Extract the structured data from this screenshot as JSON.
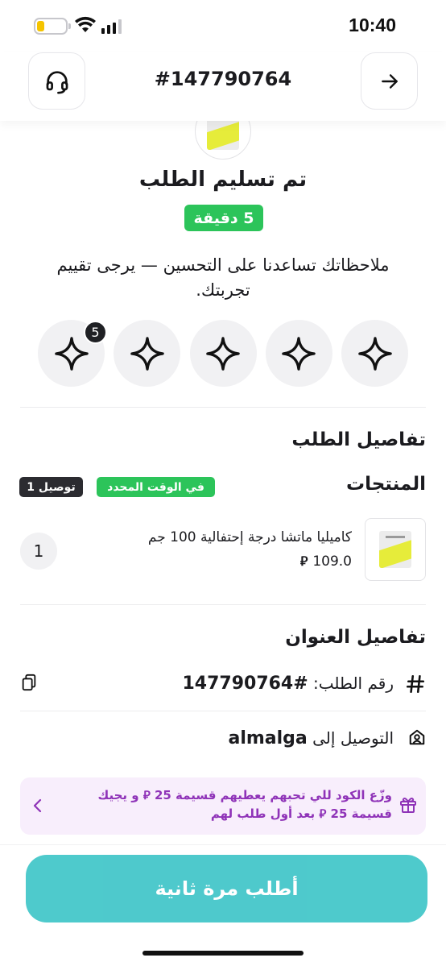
{
  "status_bar": {
    "time": "10:40",
    "battery_level": 0.25
  },
  "header": {
    "order_number": "#147790764",
    "back_icon": "arrow-right-icon",
    "support_icon": "headset-icon"
  },
  "status": {
    "title": "تم تسليم الطلب",
    "time_badge": "5 دقيقة",
    "feedback_text": "ملاحظاتك تساعدنا على التحسين — يرجى تقييم تجربتك.",
    "stars_count": 5,
    "stars_badge": "5"
  },
  "order_details": {
    "title": "تفاصيل الطلب",
    "products_label": "المنتجات",
    "on_time_badge": "في الوقت المحدد",
    "delivery_badge": "توصيل 1",
    "products": [
      {
        "name": "كاميليا ماتشا درجة إحتفالية 100 جم",
        "price": "109.0",
        "currency_symbol": "⃁",
        "quantity": "1"
      }
    ]
  },
  "address_details": {
    "title": "تفاصيل العنوان",
    "order_number_label": "رقم الطلب:",
    "order_number_value": "#147790764",
    "delivery_label": "التوصيل إلى",
    "delivery_value": "almalga"
  },
  "gift_banner": {
    "text": "وزّع الكود للي تحبهم يعطيهم قسيمة 25 ⃁ و يجيك قسيمة 25 ⃁ بعد أول طلب لهم"
  },
  "bottom": {
    "reorder_label": "أطلب مرة ثانية"
  },
  "colors": {
    "green": "#2cc45a",
    "teal": "#3fc5c8",
    "purple": "#8f33b8",
    "dark_pill": "#2b2b30"
  }
}
